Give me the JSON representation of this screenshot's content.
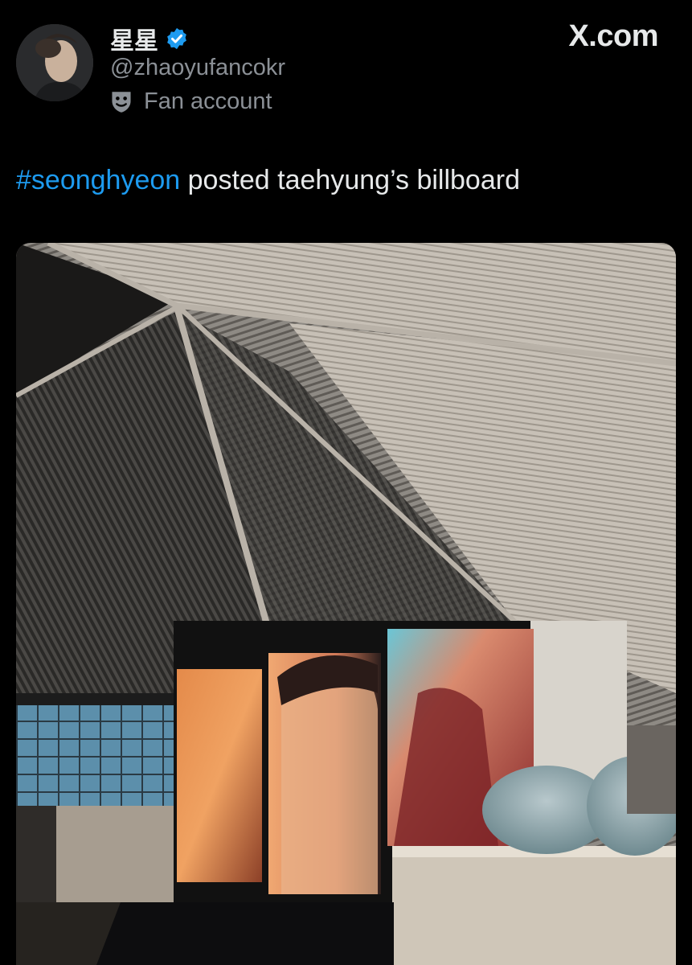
{
  "header": {
    "display_name": "星星",
    "handle": "@zhaoyufancokr",
    "account_label": "Fan account",
    "site": "X.com"
  },
  "icons": {
    "verified": "verified-badge-icon",
    "label": "theater-mask-icon",
    "avatar": "profile-avatar"
  },
  "colors": {
    "background": "#000000",
    "text": "#e7e9ea",
    "muted": "#8b9096",
    "hashtag": "#1d9bf0",
    "verified": "#1d9bf0"
  },
  "tweet": {
    "hashtag": "#seonghyeon",
    "text": " posted taehyung’s billboard"
  },
  "media": {
    "type": "photo",
    "subject": "billboard-photo"
  }
}
